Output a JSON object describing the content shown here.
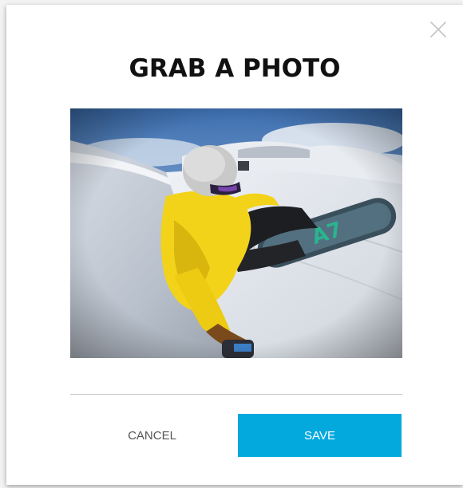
{
  "dialog": {
    "title": "GRAB A PHOTO",
    "photo_alt": "Snowboarder in a yellow jacket riding down a snowy mountain slope",
    "cancel_label": "CANCEL",
    "save_label": "SAVE"
  },
  "icons": {
    "close": "close-icon"
  },
  "colors": {
    "accent": "#03A9DD",
    "title": "#111111",
    "divider": "#C8C8C8",
    "cancel_text": "#555555"
  }
}
